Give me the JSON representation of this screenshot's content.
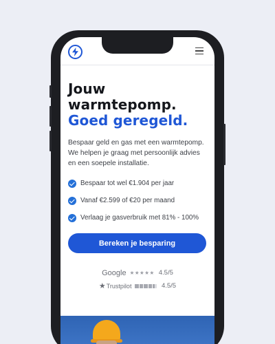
{
  "header": {
    "logo_icon": "lightning-bolt-icon",
    "menu_icon": "hamburger-menu-icon"
  },
  "hero": {
    "title_line1": "Jouw",
    "title_line2": "warmtepomp.",
    "title_accent": "Goed geregeld.",
    "intro": "Bespaar geld en gas met een warmtepomp. We helpen je graag met persoonlijk advies en een soepele installatie."
  },
  "benefits": [
    {
      "text": "Bespaar tot wel €1.904 per jaar"
    },
    {
      "text": "Vanaf €2.599 of  €20 per maand"
    },
    {
      "text": "Verlaag je gasverbruik met 81% - 100%"
    }
  ],
  "cta": {
    "label": "Bereken je besparing"
  },
  "ratings": {
    "google": {
      "brand": "Google",
      "stars": "★★★★★",
      "score": "4.5/5"
    },
    "trustpilot": {
      "brand": "Trustpilot",
      "score": "4.5/5"
    }
  },
  "colors": {
    "accent": "#1f57d6",
    "check": "#2470d8",
    "background": "#eceef5"
  }
}
